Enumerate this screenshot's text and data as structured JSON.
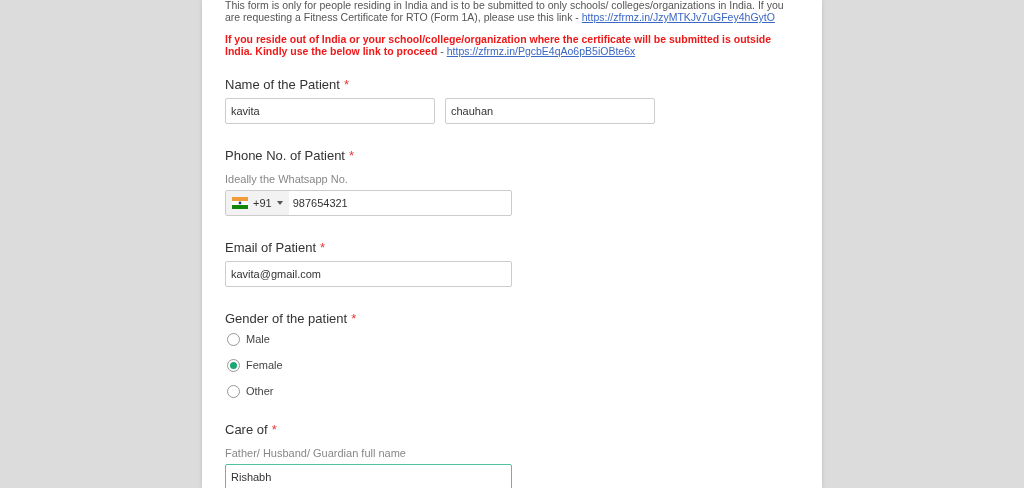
{
  "notices": [
    {
      "kind": "info",
      "text": "This form is only for people residing in India and is to be submitted to only schools/ colleges/organizations in India. If you are requesting a Fitness Certificate for RTO (Form 1A), please use this link - ",
      "link": "https://zfrmz.in/JzyMTKJv7uGFey4hGytO"
    },
    {
      "kind": "warning",
      "text": "If you reside out of India or your school/college/organization where the certificate will be submitted is outside India. Kindly use the below link to proceed",
      "separator": " - ",
      "link": "https://zfrmz.in/PgcbE4qAo6pB5iOBte6x"
    }
  ],
  "fields": [
    {
      "kind": "name",
      "label": "Name of the Patient",
      "required_mark": "*",
      "first": "kavita",
      "last": "chauhan"
    },
    {
      "kind": "phone",
      "label": "Phone No. of Patient",
      "required_mark": "*",
      "hint": "Ideally the Whatsapp No.",
      "country_code": "+91",
      "value": "987654321"
    },
    {
      "kind": "text",
      "label": "Email of Patient",
      "required_mark": "*",
      "value": "kavita@gmail.com",
      "focused": false
    },
    {
      "kind": "radio",
      "label": "Gender of the patient",
      "required_mark": "*",
      "options": [
        {
          "label": "Male",
          "selected": false
        },
        {
          "label": "Female",
          "selected": true
        },
        {
          "label": "Other",
          "selected": false
        }
      ]
    },
    {
      "kind": "text",
      "label": "Care of",
      "required_mark": "*",
      "hint": "Father/ Husband/ Guardian full name",
      "value": "Rishabh",
      "focused": true
    }
  ]
}
